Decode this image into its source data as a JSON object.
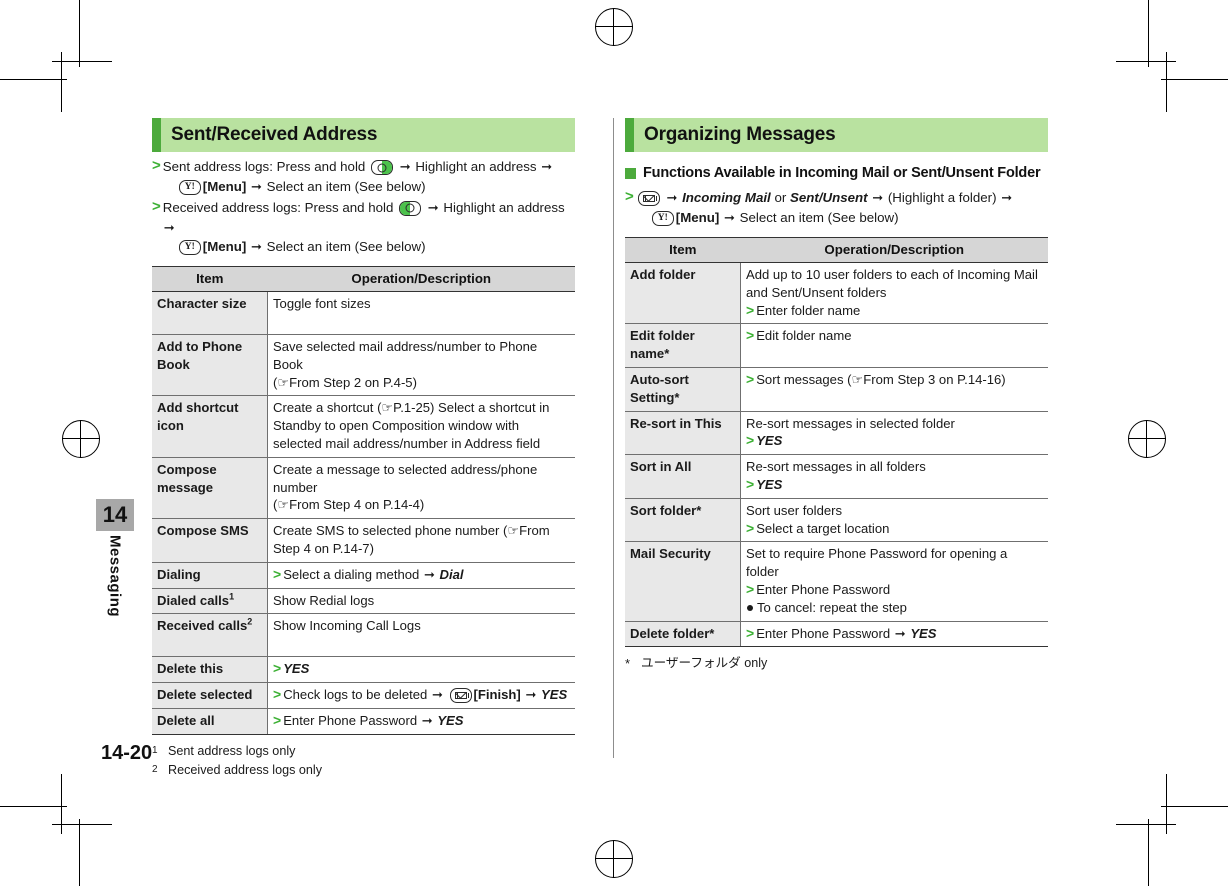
{
  "page": {
    "folio": "14-20",
    "chapter_number": "14",
    "chapter_name": "Messaging"
  },
  "left_column": {
    "section_title": "Sent/Received Address",
    "steps": [
      {
        "line1_pre": "Sent address logs: Press and hold",
        "key1": "soft-key-right-green",
        "line1_post": "Highlight an address",
        "line2_key": "yahoo-key",
        "line2_a": "[Menu]",
        "line2_b": "Select an item (See below)"
      },
      {
        "line1_pre": "Received address logs: Press and hold",
        "key1": "soft-key-left-green",
        "line1_post": "Highlight an address",
        "line2_key": "yahoo-key",
        "line2_a": "[Menu]",
        "line2_b": "Select an item (See below)"
      }
    ],
    "table": {
      "headers": [
        "Item",
        "Operation/Description"
      ],
      "rows": [
        {
          "item": "Character size",
          "desc_lines": [
            "Toggle font sizes"
          ]
        },
        {
          "item": "Add to Phone Book",
          "desc_lines": [
            "Save selected mail address/number to Phone Book",
            "(☞From Step 2 on P.4-5)"
          ]
        },
        {
          "item": "Add shortcut icon",
          "desc_lines": [
            "Create a shortcut (☞P.1-25) Select a shortcut in Standby to open Composition window with selected mail address/number in Address field"
          ]
        },
        {
          "item": "Compose message",
          "desc_lines": [
            "Create a message to selected address/phone number",
            "(☞From Step 4 on P.14-4)"
          ]
        },
        {
          "item": "Compose SMS",
          "desc_lines": [
            "Create SMS to selected phone number (☞From Step 4 on P.14-7)"
          ]
        },
        {
          "item": "Dialing",
          "step_text": "Select a dialing method",
          "step_arrow_value": "Dial"
        },
        {
          "item": "Dialed calls",
          "item_sup": "1",
          "desc_lines": [
            "Show Redial logs"
          ]
        },
        {
          "item": "Received calls",
          "item_sup": "2",
          "desc_lines": [
            "Show Incoming Call Logs"
          ]
        },
        {
          "item": "Delete this",
          "step_value_only": "YES"
        },
        {
          "item": "Delete selected",
          "step_text": "Check logs to be deleted",
          "step_key": "mail-key",
          "step_key_label": "[Finish]",
          "step_arrow_value": "YES"
        },
        {
          "item": "Delete all",
          "step_text": "Enter Phone Password",
          "step_arrow_value": "YES"
        }
      ]
    },
    "footnotes": [
      {
        "mark": "1",
        "text": "Sent address logs only"
      },
      {
        "mark": "2",
        "text": "Received address logs only"
      }
    ]
  },
  "right_column": {
    "section_title": "Organizing Messages",
    "sub_heading": "Functions Available in Incoming Mail or Sent/Unsent Folder",
    "step": {
      "key1": "mail-key",
      "italic1": "Incoming Mail",
      "or": "or",
      "italic2": "Sent/Unsent",
      "paren": "(Highlight a folder)",
      "line2_key": "yahoo-key",
      "line2_a": "[Menu]",
      "line2_b": "Select an item (See below)"
    },
    "table": {
      "headers": [
        "Item",
        "Operation/Description"
      ],
      "rows": [
        {
          "item": "Add folder",
          "desc_lines": [
            "Add up to 10 user folders to each of Incoming Mail and Sent/Unsent folders"
          ],
          "step_text": "Enter folder name"
        },
        {
          "item": "Edit folder name*",
          "step_text": "Edit folder name"
        },
        {
          "item": "Auto-sort Setting*",
          "step_text": "Sort messages (☞From Step 3 on P.14-16)"
        },
        {
          "item": "Re-sort in This",
          "desc_lines": [
            "Re-sort messages in selected folder"
          ],
          "step_value_only": "YES"
        },
        {
          "item": "Sort in All",
          "desc_lines": [
            "Re-sort messages in all folders"
          ],
          "step_value_only": "YES"
        },
        {
          "item": "Sort folder*",
          "desc_lines": [
            "Sort user folders"
          ],
          "step_text": "Select a target location"
        },
        {
          "item": "Mail Security",
          "desc_lines": [
            "Set to require Phone Password for opening a folder"
          ],
          "step_text": "Enter Phone Password",
          "bullet_text": "To cancel: repeat the step"
        },
        {
          "item": "Delete folder*",
          "step_text": "Enter Phone Password",
          "step_arrow_value": "YES"
        }
      ]
    },
    "footnotes": [
      {
        "mark": "*",
        "text": "ユーザーフォルダ only"
      }
    ]
  },
  "colors": {
    "section_bar": "#b9e2a0",
    "accent_green": "#4caa3c",
    "step_green": "#3cb034",
    "table_header": "#d6d6d6",
    "table_item_cell": "#e8e8e8",
    "chapter_tab": "#a8a8a8"
  }
}
